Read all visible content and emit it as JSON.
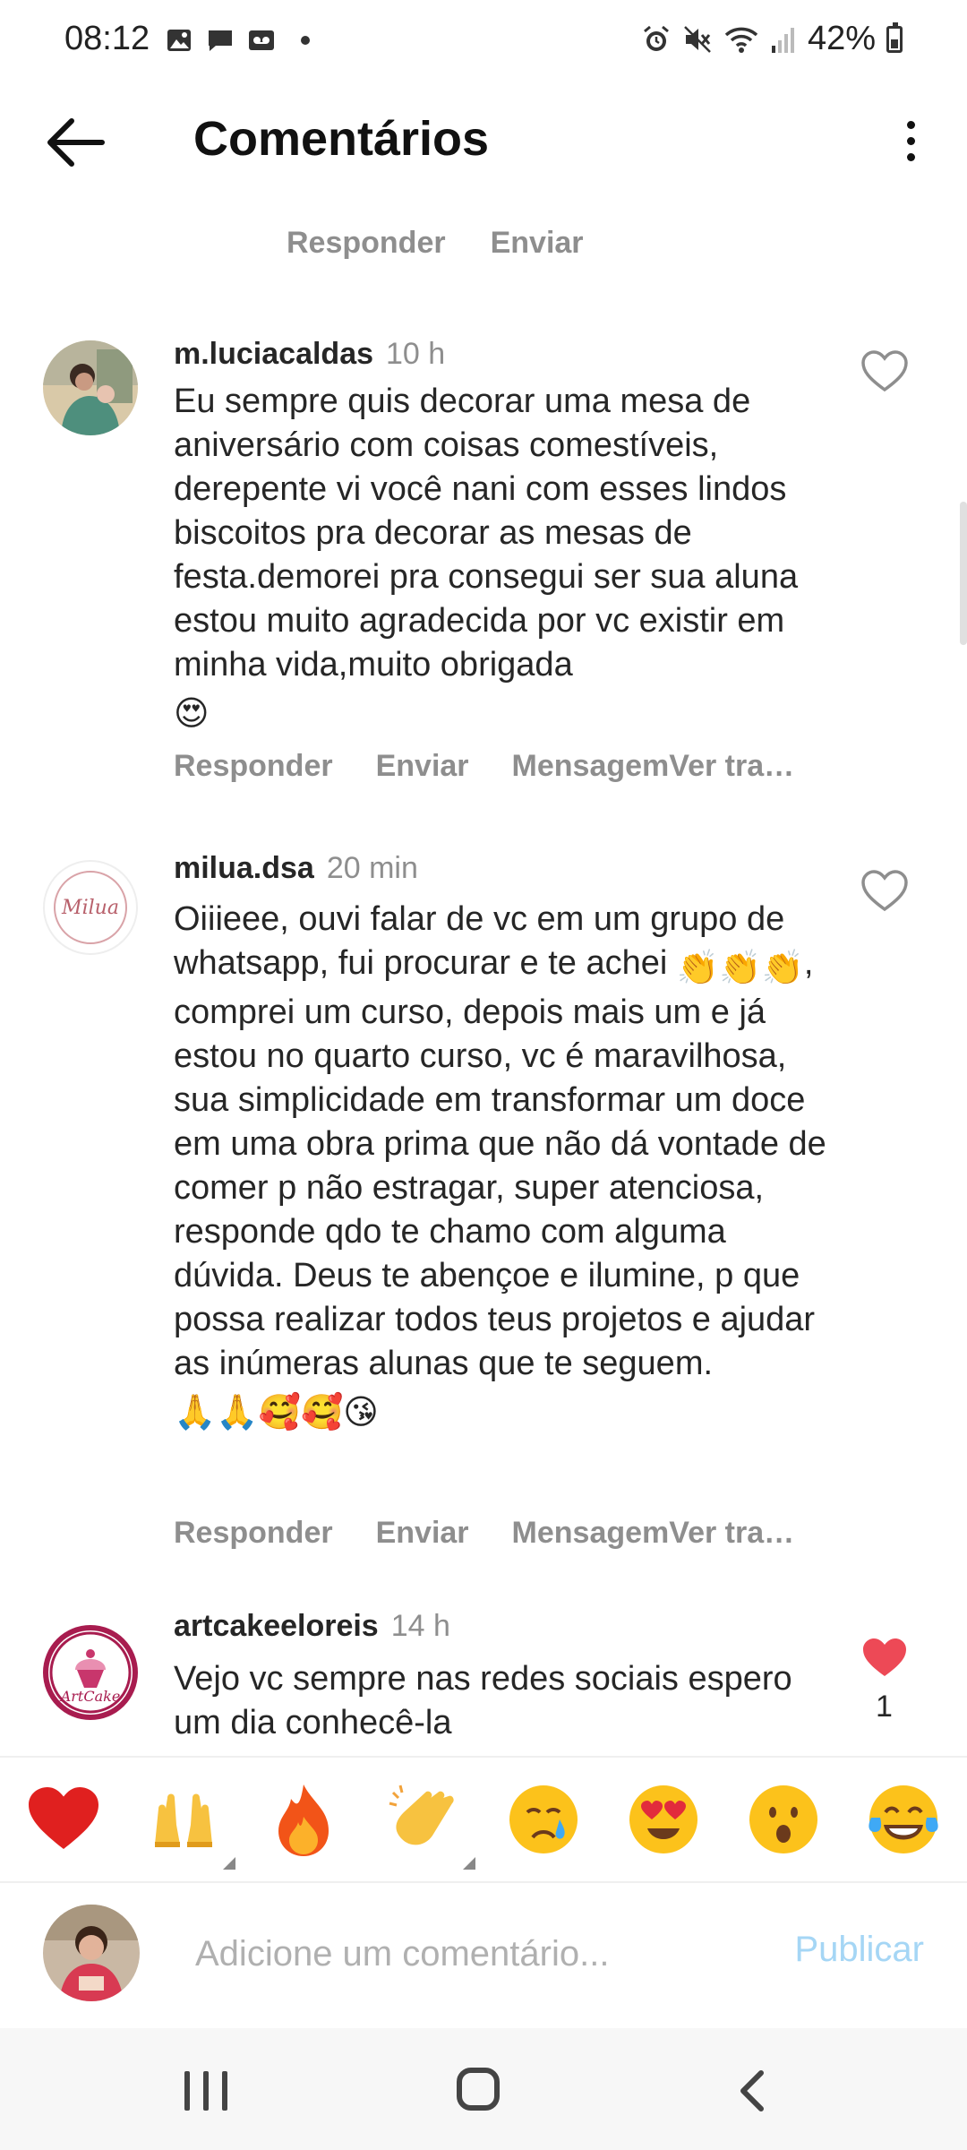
{
  "status_bar": {
    "time": "08:12",
    "battery": "42%"
  },
  "header": {
    "title": "Comentários"
  },
  "previous_comment_actions": {
    "reply": "Responder",
    "send": "Enviar"
  },
  "comments": [
    {
      "username": "m.luciacaldas",
      "time": "10 h",
      "text": "Eu sempre quis decorar uma mesa de aniversário com coisas comestíveis, derepente vi você nani com esses lindos biscoitos pra decorar as mesas de festa.demorei pra consegui ser sua aluna estou muito agradecida por vc existir em minha vida,muito obrigada",
      "emojis": "😍",
      "actions": {
        "reply": "Responder",
        "send": "Enviar",
        "message": "MensagemVer tra…"
      },
      "liked": false
    },
    {
      "username": "milua.dsa",
      "time": "20 min",
      "text_part1": "Oiiieee, ouvi falar de vc em um grupo de whatsapp, fui procurar e te achei",
      "emojis_inline": "👏👏👏",
      "text_part2": ", comprei um curso, depois mais um e já estou no quarto curso, vc é maravilhosa, sua simplicidade em transformar um doce em uma obra prima que não dá vontade de comer p não estragar, super atenciosa, responde qdo te chamo com alguma dúvida. Deus te abençoe e ilumine, p que possa realizar todos teus projetos e ajudar as inúmeras alunas que te seguem.",
      "emojis_end": "🙏🙏🥰🥰😘",
      "actions": {
        "reply": "Responder",
        "send": "Enviar",
        "message": "MensagemVer tra…"
      },
      "liked": false,
      "avatar_text": "Milua"
    },
    {
      "username": "artcakeeloreis",
      "time": "14 h",
      "text": "Vejo vc sempre nas redes sociais espero um dia conhecê-la",
      "liked": true,
      "like_count": "1",
      "avatar_text": "ArtCake"
    }
  ],
  "reactions": [
    "❤️",
    "🙌",
    "🔥",
    "👏",
    "😢",
    "😍",
    "😮",
    "😂"
  ],
  "input": {
    "placeholder": "Adicione um comentário...",
    "publish": "Publicar"
  },
  "colors": {
    "muted": "#8e8e8e",
    "like_red": "#ed4956",
    "publish_blue": "#a5d6f5"
  }
}
